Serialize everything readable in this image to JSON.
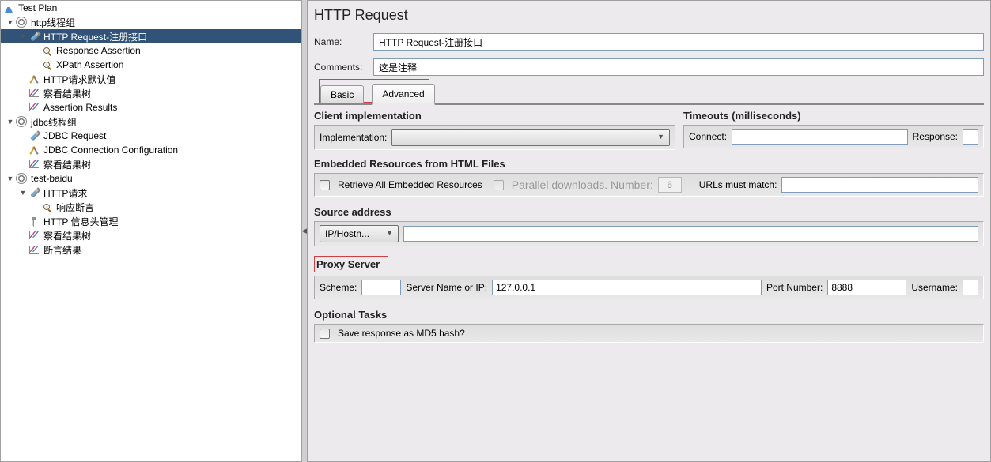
{
  "tree": {
    "root": "Test Plan",
    "g1": {
      "name": "http线程组",
      "req": "HTTP Request-注册接口",
      "a1": "Response Assertion",
      "a2": "XPath Assertion",
      "def": "HTTP请求默认值",
      "tree1": "察看结果树",
      "ar": "Assertion Results"
    },
    "g2": {
      "name": "jdbc线程组",
      "req": "JDBC Request",
      "conf": "JDBC Connection Configuration",
      "tree1": "察看结果树"
    },
    "g3": {
      "name": "test-baidu",
      "req": "HTTP请求",
      "a1": "响应断言",
      "hdr": "HTTP 信息头管理",
      "tree1": "察看结果树",
      "ar": "断言结果"
    }
  },
  "panel": {
    "title": "HTTP Request",
    "nameLabel": "Name:",
    "nameValue": "HTTP Request-注册接口",
    "commentsLabel": "Comments:",
    "commentsValue": "这是注释",
    "tabs": {
      "basic": "Basic",
      "advanced": "Advanced"
    },
    "clientImpl": {
      "title": "Client implementation",
      "label": "Implementation:"
    },
    "timeouts": {
      "title": "Timeouts (milliseconds)",
      "connect": "Connect:",
      "response": "Response:"
    },
    "embedded": {
      "title": "Embedded Resources from HTML Files",
      "retrieve": "Retrieve All Embedded Resources",
      "parallel": "Parallel downloads. Number:",
      "parallelNum": "6",
      "urlsMatch": "URLs must match:"
    },
    "source": {
      "title": "Source address",
      "combo": "IP/Hostn..."
    },
    "proxy": {
      "title": "Proxy Server",
      "scheme": "Scheme:",
      "server": "Server Name or IP:",
      "serverValue": "127.0.0.1",
      "port": "Port Number:",
      "portValue": "8888",
      "username": "Username:"
    },
    "optional": {
      "title": "Optional Tasks",
      "md5": "Save response as MD5 hash?"
    }
  }
}
